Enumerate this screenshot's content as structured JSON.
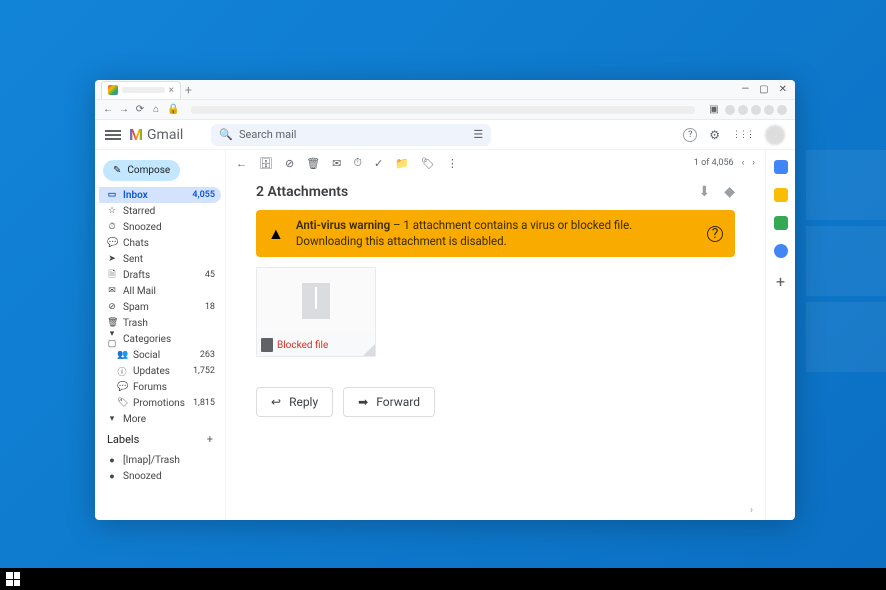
{
  "browser": {
    "new_tab_glyph": "+",
    "tab_close_glyph": "×",
    "win_min": "—",
    "win_max": "▢",
    "win_close": "✕",
    "nav_back": "←",
    "nav_fwd": "→",
    "nav_reload": "⟳",
    "nav_home": "⌂",
    "lock": "🔒",
    "ext_box": "▣"
  },
  "header": {
    "brand": "Gmail",
    "search_placeholder": "Search mail",
    "search_icon": "🔍",
    "tune_icon": "☰",
    "help_glyph": "?",
    "settings_glyph": "⚙",
    "apps_glyph": "⋮⋮⋮"
  },
  "sidebar": {
    "compose_label": "Compose",
    "items": [
      {
        "icon": "▭",
        "label": "Inbox",
        "count": "4,055",
        "active": true
      },
      {
        "icon": "☆",
        "label": "Starred",
        "count": ""
      },
      {
        "icon": "⏱",
        "label": "Snoozed",
        "count": ""
      },
      {
        "icon": "💬",
        "label": "Chats",
        "count": ""
      },
      {
        "icon": "➤",
        "label": "Sent",
        "count": ""
      },
      {
        "icon": "🗎",
        "label": "Drafts",
        "count": "45"
      },
      {
        "icon": "✉",
        "label": "All Mail",
        "count": ""
      },
      {
        "icon": "⊘",
        "label": "Spam",
        "count": "18"
      },
      {
        "icon": "🗑",
        "label": "Trash",
        "count": ""
      }
    ],
    "categories_label": "Categories",
    "categories_icon": "▾ ▢",
    "categories": [
      {
        "icon": "👥",
        "label": "Social",
        "count": "263"
      },
      {
        "icon": "ⓘ",
        "label": "Updates",
        "count": "1,752"
      },
      {
        "icon": "💬",
        "label": "Forums",
        "count": ""
      },
      {
        "icon": "🏷",
        "label": "Promotions",
        "count": "1,815"
      }
    ],
    "more_label": "More",
    "more_icon": "▾",
    "labels_header": "Labels",
    "labels": [
      {
        "icon": "●",
        "label": "[Imap]/Trash"
      },
      {
        "icon": "●",
        "label": "Snoozed"
      }
    ]
  },
  "toolbar": {
    "back": "←",
    "archive": "🗄",
    "report": "⊘",
    "delete": "🗑",
    "unread": "✉",
    "snooze": "⏱",
    "addtask": "✓",
    "move": "📁",
    "label": "🏷",
    "more": "⋮",
    "pager": "1 of 4,056",
    "prev": "‹",
    "next": "›"
  },
  "content": {
    "attachments_title": "2 Attachments",
    "download_all_glyph": "⬇",
    "drive_glyph": "◆",
    "warning_bold": "Anti-virus warning",
    "warning_rest": " – 1 attachment contains a virus or blocked file. Downloading this attachment is disabled.",
    "warning_icon": "▲",
    "help_icon": "?",
    "blocked_label": "Blocked file",
    "reply_label": "Reply",
    "reply_glyph": "↩",
    "forward_label": "Forward",
    "forward_glyph": "➡",
    "scroll_hint": "›"
  },
  "sidepanel": {
    "plus": "+"
  }
}
